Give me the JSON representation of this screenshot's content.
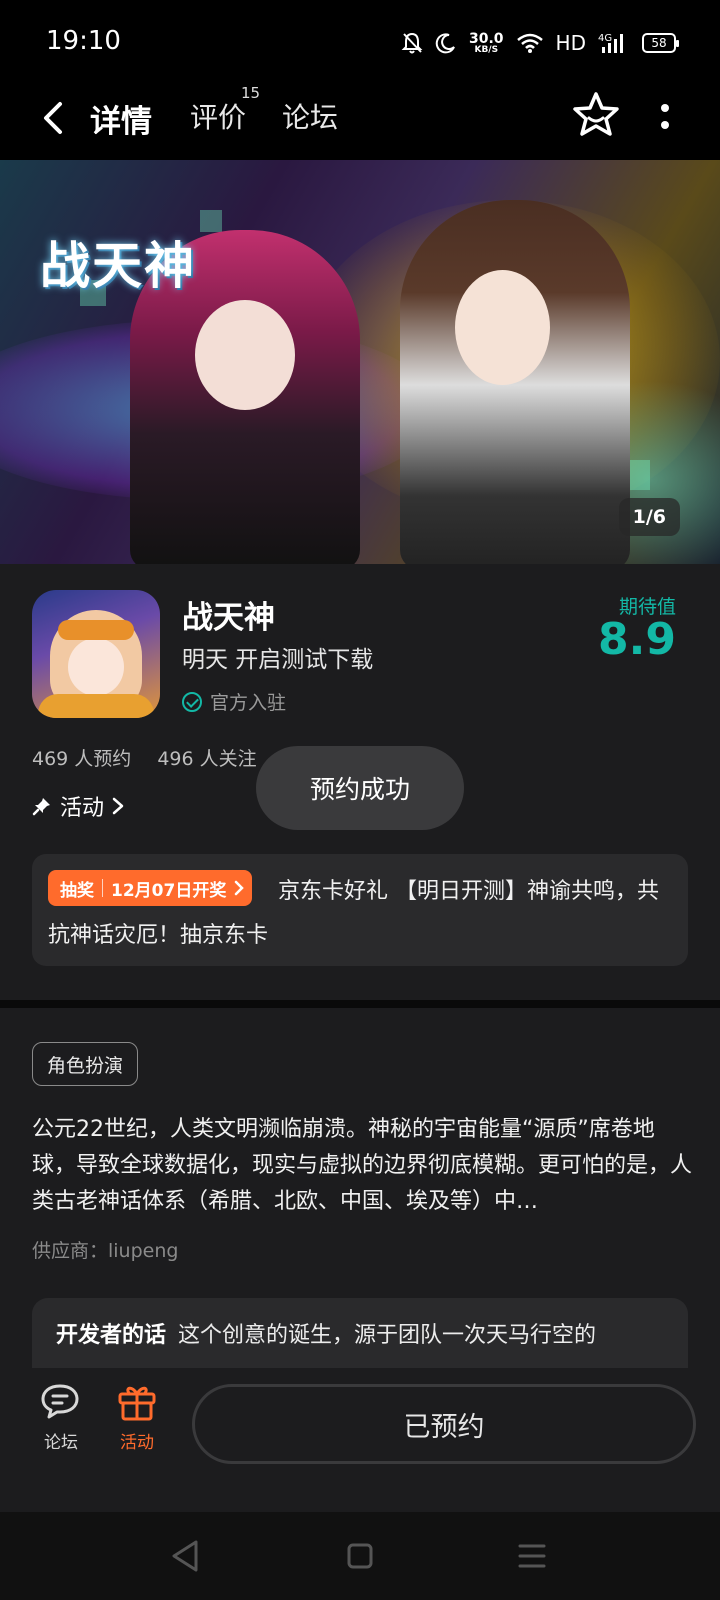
{
  "status_bar": {
    "time": "19:10",
    "net_speed_value": "30.0",
    "net_speed_unit": "KB/S",
    "hd": "HD",
    "signal_label": "4G",
    "battery": "58"
  },
  "nav": {
    "tabs": [
      {
        "label": "详情",
        "active": true
      },
      {
        "label": "评价",
        "badge": "15"
      },
      {
        "label": "论坛"
      }
    ]
  },
  "banner": {
    "logo_text": "战天神",
    "page_indicator": "1/6"
  },
  "game": {
    "title": "战天神",
    "subtitle": "明天 开启测试下载",
    "official_label": "官方入驻",
    "expect_label": "期待值",
    "expect_value": "8.9",
    "reserve_count": "469 人预约",
    "follow_count": "496 人关注"
  },
  "activity": {
    "heading": "活动",
    "badge_type": "抽奖",
    "badge_date": "12月07日开奖",
    "text": "京东卡好礼 【明日开测】神谕共鸣，共抗神话灾厄！抽京东卡"
  },
  "toast": "预约成功",
  "description": {
    "genre_tag": "角色扮演",
    "text": "公元22世纪，人类文明濒临崩溃。神秘的宇宙能量“源质”席卷地球，导致全球数据化，现实与虚拟的边界彻底模糊。更可怕的是，人类古老神话体系（希腊、北欧、中国、埃及等）中…",
    "supplier": "供应商：liupeng",
    "dev_heading": "开发者的话",
    "dev_text": "这个创意的诞生，源于团队一次天马行空的"
  },
  "bottom_bar": {
    "forum_label": "论坛",
    "activity_label": "活动",
    "reserved_label": "已预约"
  },
  "colors": {
    "accent": "#13b8a6",
    "orange": "#ff6b2c",
    "background": "#1c1c1e"
  }
}
